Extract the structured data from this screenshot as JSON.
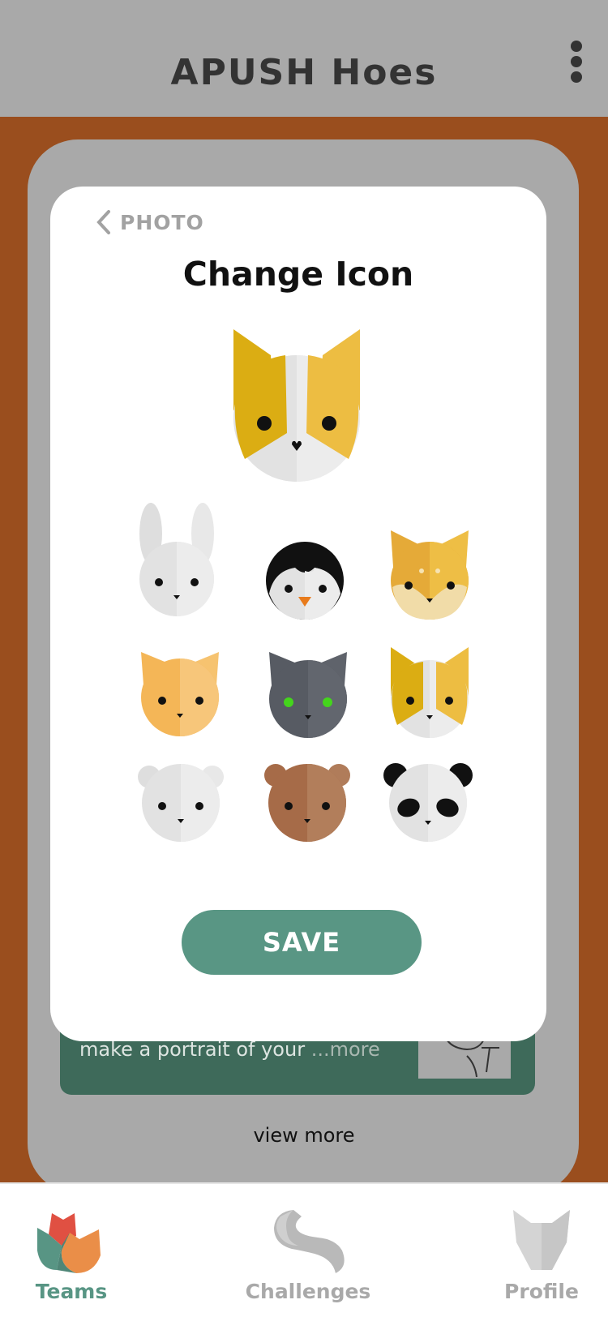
{
  "header": {
    "title": "APUSH Hoes",
    "menu_icon": "more-vertical-icon"
  },
  "background": {
    "card_text": "make a portrait of your ",
    "card_more": "...more",
    "view_more": "view more"
  },
  "modal": {
    "back_label": "PHOTO",
    "back_icon": "chevron-left-icon",
    "title": "Change Icon",
    "selected_icon": "corgi-icon",
    "options": [
      {
        "name": "bunny-icon"
      },
      {
        "name": "penguin-icon"
      },
      {
        "name": "fox-icon"
      },
      {
        "name": "orange-cat-icon"
      },
      {
        "name": "grey-cat-icon"
      },
      {
        "name": "corgi-icon"
      },
      {
        "name": "polar-bear-icon"
      },
      {
        "name": "brown-bear-icon"
      },
      {
        "name": "panda-icon"
      }
    ],
    "save_label": "SAVE"
  },
  "tabbar": {
    "tabs": [
      {
        "label": "Teams",
        "icon": "teams-icon",
        "active": true
      },
      {
        "label": "Challenges",
        "icon": "challenges-icon",
        "active": false
      },
      {
        "label": "Profile",
        "icon": "profile-icon",
        "active": false
      }
    ]
  },
  "colors": {
    "accent": "#599684",
    "header_bg": "#a9a9a9",
    "page_bg": "#9a4e1e"
  }
}
